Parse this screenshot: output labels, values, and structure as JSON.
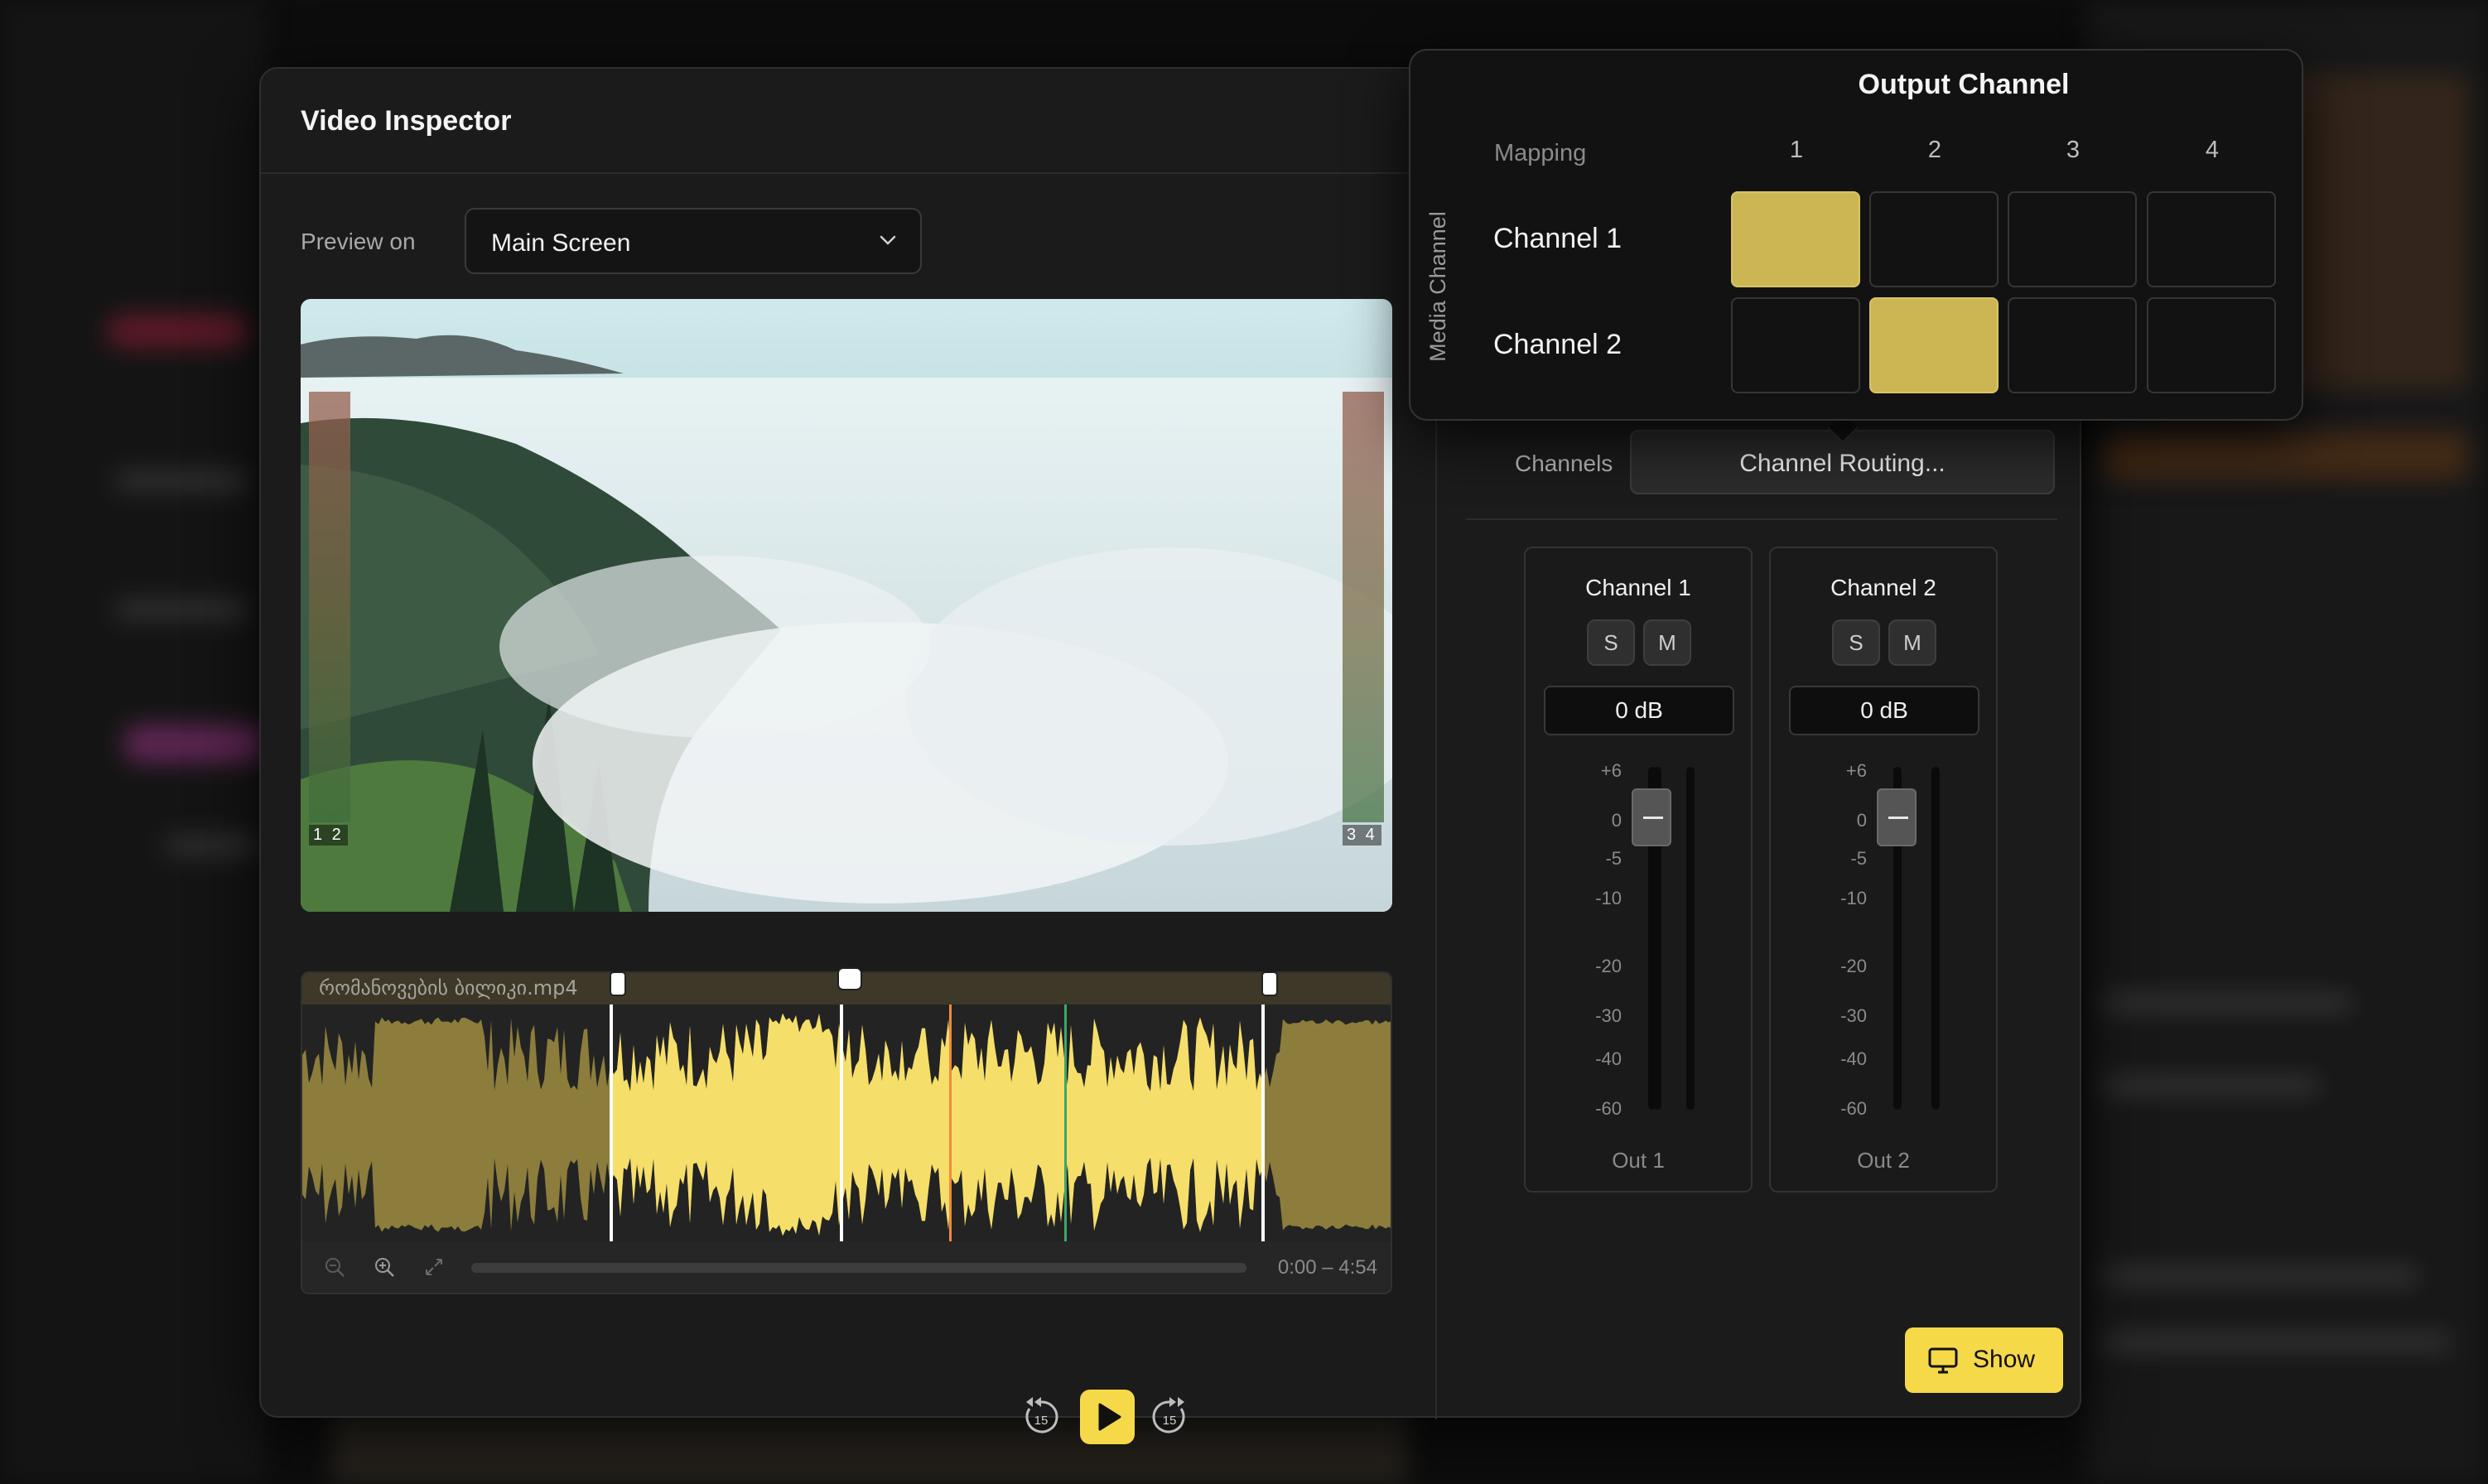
{
  "inspector": {
    "title": "Video Inspector",
    "preview_label": "Preview on",
    "preview_value": "Main Screen"
  },
  "video": {
    "meter_left_label": "1 2",
    "meter_right_label": "3 4"
  },
  "timeline": {
    "filename": "რომანოვების ბილიკი.mp4",
    "timecode": "0:00 – 4:54",
    "markers": [
      {
        "color": "#5b8de8"
      },
      {
        "color": "#f08a3c"
      },
      {
        "color": "#3aa86a"
      }
    ],
    "waveform_color": "#f5df6a",
    "waveform_dim_color": "#8c7d3c"
  },
  "transport": {
    "skip_back_seconds": "15",
    "skip_forward_seconds": "15"
  },
  "channels": {
    "label": "Channels",
    "routing_button": "Channel Routing...",
    "strips": [
      {
        "title": "Channel 1",
        "solo": "S",
        "mute": "M",
        "gain": "0 dB",
        "output": "Out 1"
      },
      {
        "title": "Channel 2",
        "solo": "S",
        "mute": "M",
        "gain": "0 dB",
        "output": "Out 2"
      }
    ],
    "scale": [
      "+6",
      "0",
      "-5",
      "-10",
      "-20",
      "-30",
      "-40",
      "-60"
    ]
  },
  "show_button": "Show",
  "routing_popover": {
    "title": "Output Channel",
    "mapping_label": "Mapping",
    "row_axis_label": "Media Channel",
    "columns": [
      "1",
      "2",
      "3",
      "4"
    ],
    "rows": [
      {
        "label": "Channel 1",
        "active": [
          true,
          false,
          false,
          false
        ]
      },
      {
        "label": "Channel 2",
        "active": [
          false,
          true,
          false,
          false
        ]
      }
    ],
    "accent_color": "#cbb653"
  }
}
